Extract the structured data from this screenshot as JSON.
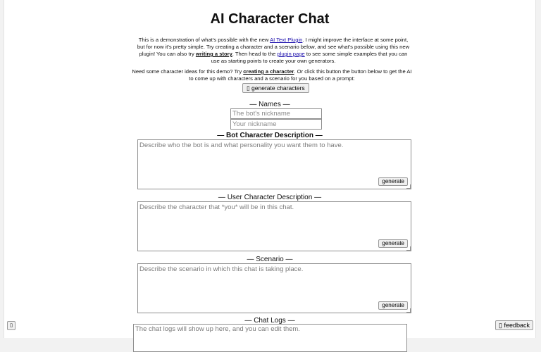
{
  "header": {
    "title": "AI Character Chat"
  },
  "intro": {
    "p1_a": "This is a demonstration of what's possible with the new ",
    "ai_text_plugin_link": "AI Text Plugin",
    "p1_b": ". I might improve the interface at some point, but for now it's pretty simple. Try creating a character and a scenario below, and see what's possible using this new plugin! You can also try ",
    "writing_story_link": "writing a story",
    "p1_c": ". Then head to the ",
    "plugin_page_link": "plugin page",
    "p1_d": " to see some simple examples that you can use as starting points to create your own generators.",
    "p2_a": "Need some character ideas for this demo? Try ",
    "creating_character_link": "creating a character",
    "p2_b": ". Or click this button the button below to get the AI to come up with characters and a scenario for you based on a prompt:"
  },
  "generate_characters_button": "▯ generate characters",
  "names": {
    "label": "— Names —",
    "bot_placeholder": "The bot's nickname",
    "user_placeholder": "Your nickname"
  },
  "bot_description": {
    "label": "— Bot Character Description —",
    "placeholder": "Describe who the bot is and what personality you want them to have.",
    "button": "generate"
  },
  "user_description": {
    "label": "— User Character Description —",
    "placeholder": "Describe the character that *you* will be in this chat.",
    "button": "generate"
  },
  "scenario": {
    "label": "— Scenario —",
    "placeholder": "Describe the scenario in which this chat is taking place.",
    "button": "generate"
  },
  "chat_logs": {
    "label": "— Chat Logs —",
    "placeholder": "The chat logs will show up here, and you can edit them."
  },
  "corner_button": "▯",
  "feedback_button": "▯ feedback"
}
